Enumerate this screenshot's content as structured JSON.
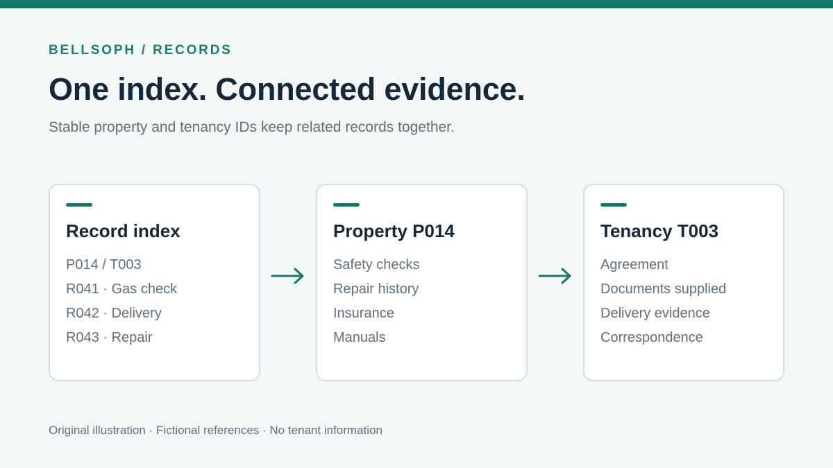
{
  "eyebrow": "BELLSOPH / RECORDS",
  "title": "One index. Connected evidence.",
  "subtitle": "Stable property and tenancy IDs keep related records together.",
  "cards": [
    {
      "title": "Record index",
      "lines": [
        "P014 / T003",
        "R041 · Gas check",
        "R042 · Delivery",
        "R043 · Repair"
      ]
    },
    {
      "title": "Property P014",
      "lines": [
        "Safety checks",
        "Repair history",
        "Insurance",
        "Manuals"
      ]
    },
    {
      "title": "Tenancy T003",
      "lines": [
        "Agreement",
        "Documents supplied",
        "Delivery evidence",
        "Correspondence"
      ]
    }
  ],
  "arrows": [
    "arrow-right-icon",
    "arrow-right-icon"
  ],
  "footer": "Original illustration · Fictional references · No tenant information",
  "colors": {
    "accent": "#12786a",
    "heading": "#12293d",
    "body": "#5d6f7c",
    "card_border": "#d2e0e4",
    "background": "#f3f7f8"
  }
}
